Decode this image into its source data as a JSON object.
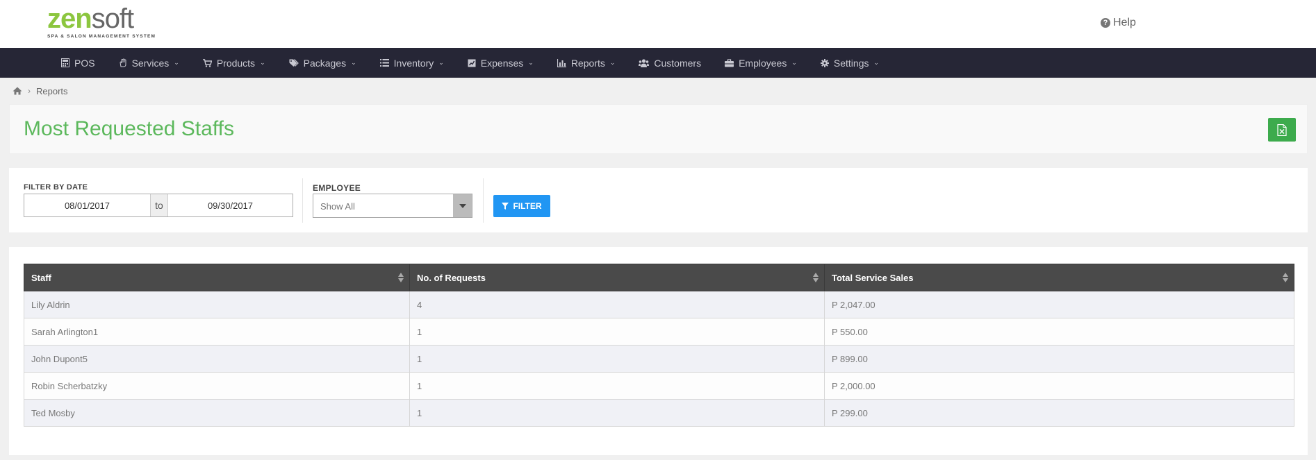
{
  "logo": {
    "zen": "zen",
    "soft": "soft",
    "tagline": "SPA & SALON MANAGEMENT SYSTEM"
  },
  "header": {
    "help_label": "Help"
  },
  "nav": [
    {
      "label": "POS",
      "icon": "calculator-icon",
      "dropdown": false
    },
    {
      "label": "Services",
      "icon": "hand-icon",
      "dropdown": true
    },
    {
      "label": "Products",
      "icon": "cart-icon",
      "dropdown": true
    },
    {
      "label": "Packages",
      "icon": "tags-icon",
      "dropdown": true
    },
    {
      "label": "Inventory",
      "icon": "list-icon",
      "dropdown": true
    },
    {
      "label": "Expenses",
      "icon": "chart-box-icon",
      "dropdown": true
    },
    {
      "label": "Reports",
      "icon": "bar-chart-icon",
      "dropdown": true
    },
    {
      "label": "Customers",
      "icon": "users-icon",
      "dropdown": false
    },
    {
      "label": "Employees",
      "icon": "briefcase-icon",
      "dropdown": true
    },
    {
      "label": "Settings",
      "icon": "gear-icon",
      "dropdown": true
    }
  ],
  "breadcrumb": {
    "current": "Reports"
  },
  "page": {
    "title": "Most Requested Staffs"
  },
  "filter": {
    "date_label": "FILTER BY DATE",
    "date_from": "08/01/2017",
    "to_label": "to",
    "date_to": "09/30/2017",
    "employee_label": "EMPLOYEE",
    "employee_value": "Show All",
    "button_label": "FILTER"
  },
  "table": {
    "columns": [
      "Staff",
      "No. of Requests",
      "Total Service Sales"
    ],
    "rows": [
      [
        "Lily Aldrin",
        "4",
        "P 2,047.00"
      ],
      [
        "Sarah Arlington1",
        "1",
        "P 550.00"
      ],
      [
        "John Dupont5",
        "1",
        "P 899.00"
      ],
      [
        "Robin Scherbatzky",
        "1",
        "P 2,000.00"
      ],
      [
        "Ted Mosby",
        "1",
        "P 299.00"
      ]
    ]
  },
  "colors": {
    "accent_green": "#5cb85c",
    "logo_green": "#8cc63f",
    "nav_bg": "#262636",
    "filter_blue": "#2196f3",
    "excel_green": "#3dab4d"
  }
}
